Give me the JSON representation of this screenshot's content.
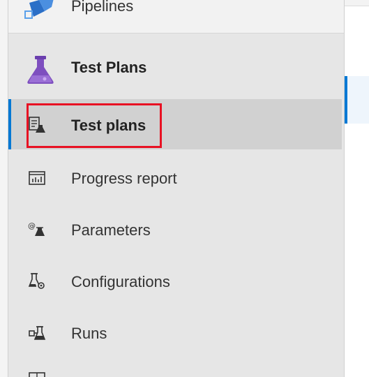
{
  "sidebar": {
    "top_item": {
      "label": "Pipelines",
      "icon": "pipelines-icon"
    },
    "hub": {
      "label": "Test Plans",
      "icon": "flask-icon",
      "icon_color": "#7e4fbf"
    },
    "items": [
      {
        "label": "Test plans",
        "icon": "test-plans-icon",
        "selected": true
      },
      {
        "label": "Progress report",
        "icon": "progress-report-icon",
        "selected": false
      },
      {
        "label": "Parameters",
        "icon": "parameters-icon",
        "selected": false
      },
      {
        "label": "Configurations",
        "icon": "configurations-icon",
        "selected": false
      },
      {
        "label": "Runs",
        "icon": "runs-icon",
        "selected": false
      }
    ]
  },
  "colors": {
    "accent": "#0078d4",
    "highlight": "#e81123",
    "sidebar_bg": "#e6e6e6",
    "selected_bg": "#d1d1d1"
  }
}
